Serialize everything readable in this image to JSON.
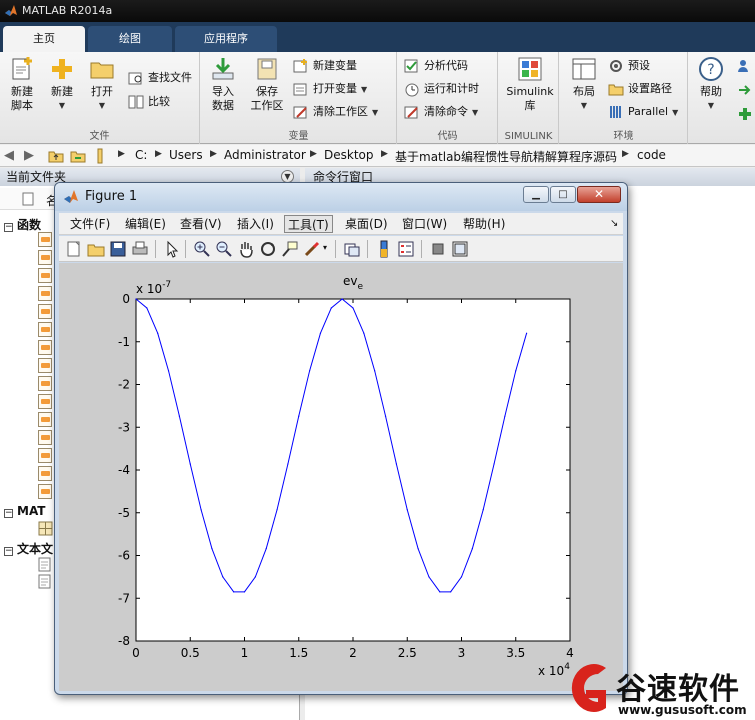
{
  "app": {
    "title": "MATLAB R2014a"
  },
  "ribbon": {
    "tabs": [
      "主页",
      "绘图",
      "应用程序"
    ],
    "sections": {
      "file": {
        "label": "文件",
        "new_script": [
          "新建",
          "脚本"
        ],
        "new": "新建",
        "open": "打开",
        "find_files": "查找文件",
        "compare": "比较"
      },
      "variable": {
        "label": "变量",
        "import_data": [
          "导入",
          "数据"
        ],
        "save_workspace": [
          "保存",
          "工作区"
        ],
        "new_variable": "新建变量",
        "open_variable": "打开变量",
        "clear_workspace": "清除工作区"
      },
      "code": {
        "label": "代码",
        "analyze": "分析代码",
        "run_time": "运行和计时",
        "clear_commands": "清除命令"
      },
      "simulink": {
        "label": "SIMULINK",
        "library": [
          "Simulink",
          "库"
        ]
      },
      "environment": {
        "label": "环境",
        "layout": "布局",
        "preferences": "预设",
        "set_path": "设置路径",
        "parallel": "Parallel"
      },
      "resources": {
        "help": "帮助"
      }
    }
  },
  "address": {
    "segments": [
      "C:",
      "Users",
      "Administrator",
      "Desktop",
      "基于matlab编程惯性导航精解算程序源码",
      "code"
    ]
  },
  "left_panel": {
    "title": "当前文件夹",
    "column": "名",
    "groups": [
      "函数",
      "MAT",
      "文本文"
    ]
  },
  "command_window": {
    "title": "命令行窗口"
  },
  "figure": {
    "title": "Figure 1",
    "menu": [
      "文件(F)",
      "编辑(E)",
      "查看(V)",
      "插入(I)",
      "工具(T)",
      "桌面(D)",
      "窗口(W)",
      "帮助(H)"
    ],
    "menu_arrow": "↘"
  },
  "chart_data": {
    "type": "line",
    "title": "ev",
    "title_subscript": "e",
    "xlabel": "",
    "ylabel": "",
    "x_exponent_label": "x 10",
    "x_exponent": "4",
    "y_exponent_label": "x 10",
    "y_exponent": "-7",
    "xlim": [
      0,
      4
    ],
    "ylim": [
      -8,
      0
    ],
    "xticks": [
      "0",
      "0.5",
      "1",
      "1.5",
      "2",
      "2.5",
      "3",
      "3.5",
      "4"
    ],
    "yticks": [
      "0",
      "-1",
      "-2",
      "-3",
      "-4",
      "-5",
      "-6",
      "-7",
      "-8"
    ],
    "grid": false,
    "series": [
      {
        "color": "#0000ff",
        "x": [
          0,
          0.1,
          0.2,
          0.3,
          0.4,
          0.5,
          0.6,
          0.7,
          0.8,
          0.9,
          1.0,
          1.1,
          1.2,
          1.3,
          1.4,
          1.5,
          1.6,
          1.7,
          1.8,
          1.9,
          2.0,
          2.1,
          2.2,
          2.3,
          2.4,
          2.5,
          2.6,
          2.7,
          2.8,
          2.9,
          3.0,
          3.1,
          3.2,
          3.3,
          3.4,
          3.5,
          3.6
        ],
        "y": [
          0,
          -0.21,
          -0.8,
          -1.68,
          -2.74,
          -3.86,
          -4.93,
          -5.84,
          -6.5,
          -6.85,
          -6.85,
          -6.5,
          -5.84,
          -4.93,
          -3.86,
          -2.74,
          -1.68,
          -0.8,
          -0.21,
          0,
          -0.21,
          -0.8,
          -1.68,
          -2.74,
          -3.86,
          -4.93,
          -5.84,
          -6.5,
          -6.85,
          -6.85,
          -6.5,
          -5.84,
          -4.93,
          -3.86,
          -2.74,
          -1.68,
          -0.8
        ]
      }
    ]
  },
  "watermark": {
    "name": "谷速软件",
    "url": "www.gususoft.com"
  },
  "colors": {
    "ribbon_tab_bar": "#1f3a5a",
    "plot_line": "#0000ff",
    "figure_background": "#cccccc"
  }
}
